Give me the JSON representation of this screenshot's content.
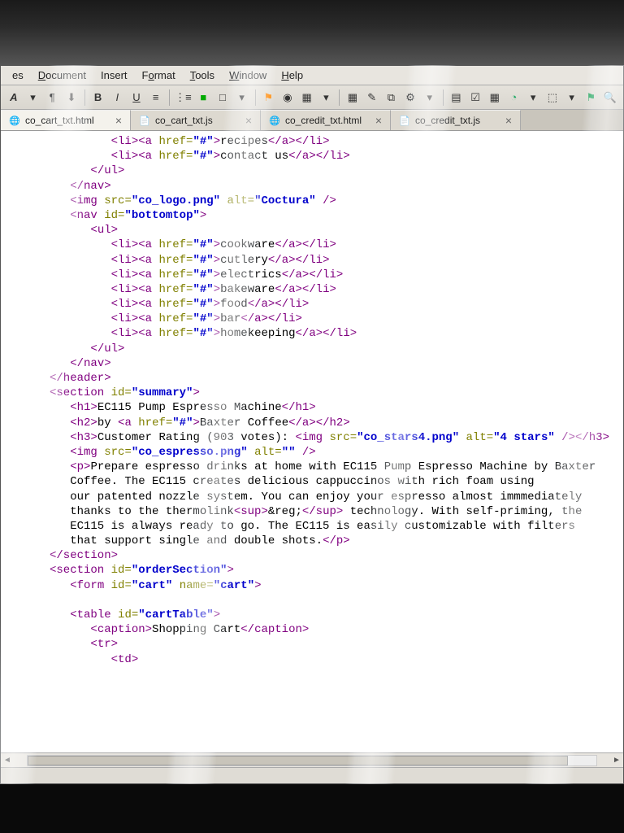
{
  "menu": {
    "items": [
      "es",
      "Document",
      "Insert",
      "Format",
      "Tools",
      "Window",
      "Help"
    ],
    "mnemonics": [
      "",
      "D",
      "",
      "o",
      "T",
      "W",
      "H"
    ]
  },
  "toolbar_icons": [
    "A",
    "▾",
    "¶",
    "⬇",
    "B",
    "I",
    "U",
    "≡",
    "⋮≡",
    "■",
    "□",
    "▾",
    "|",
    "⚑",
    "◉",
    "▦",
    "▾",
    "▦",
    "✎",
    "⧉",
    "⚙",
    "▾",
    "▤",
    "☑",
    "▦",
    "◔",
    "▾",
    "⬚",
    "▾",
    "⚑",
    "🔍"
  ],
  "tabs": [
    {
      "icon": "🌐",
      "label": "co_cart_txt.html",
      "active": true
    },
    {
      "icon": "📄",
      "label": "co_cart_txt.js",
      "active": false
    },
    {
      "icon": "🌐",
      "label": "co_credit_txt.html",
      "active": false
    },
    {
      "icon": "📄",
      "label": "co_credit_txt.js",
      "active": false
    }
  ],
  "code": {
    "prefix": "       ",
    "lines": [
      {
        "indent": 3,
        "html": "<span class='tag'>&lt;li&gt;&lt;a</span> <span class='attr-name'>href=</span><span class='attr-val'>\"#\"</span><span class='tag'>&gt;</span>recipes<span class='tag'>&lt;/a&gt;&lt;/li&gt;</span>"
      },
      {
        "indent": 3,
        "html": "<span class='tag'>&lt;li&gt;&lt;a</span> <span class='attr-name'>href=</span><span class='attr-val'>\"#\"</span><span class='tag'>&gt;</span>contact us<span class='tag'>&lt;/a&gt;&lt;/li&gt;</span>"
      },
      {
        "indent": 2,
        "html": "<span class='tag'>&lt;/ul&gt;</span>"
      },
      {
        "indent": 1,
        "html": "<span class='tag'>&lt;/nav&gt;</span>"
      },
      {
        "indent": 1,
        "html": "<span class='tag'>&lt;img</span> <span class='attr-name'>src=</span><span class='attr-val'>\"co_logo.png\"</span> <span class='attr-name'>alt=</span><span class='attr-val'>\"Coctura\"</span> <span class='tag'>/&gt;</span>"
      },
      {
        "indent": 1,
        "html": "<span class='tag'>&lt;nav</span> <span class='attr-name'>id=</span><span class='attr-val'>\"bottomtop\"</span><span class='tag'>&gt;</span>"
      },
      {
        "indent": 2,
        "html": "<span class='tag'>&lt;ul&gt;</span>"
      },
      {
        "indent": 3,
        "html": "<span class='tag'>&lt;li&gt;&lt;a</span> <span class='attr-name'>href=</span><span class='attr-val'>\"#\"</span><span class='tag'>&gt;</span>cookware<span class='tag'>&lt;/a&gt;&lt;/li&gt;</span>"
      },
      {
        "indent": 3,
        "html": "<span class='tag'>&lt;li&gt;&lt;a</span> <span class='attr-name'>href=</span><span class='attr-val'>\"#\"</span><span class='tag'>&gt;</span>cutlery<span class='tag'>&lt;/a&gt;&lt;/li&gt;</span>"
      },
      {
        "indent": 3,
        "html": "<span class='tag'>&lt;li&gt;&lt;a</span> <span class='attr-name'>href=</span><span class='attr-val'>\"#\"</span><span class='tag'>&gt;</span>electrics<span class='tag'>&lt;/a&gt;&lt;/li&gt;</span>"
      },
      {
        "indent": 3,
        "html": "<span class='tag'>&lt;li&gt;&lt;a</span> <span class='attr-name'>href=</span><span class='attr-val'>\"#\"</span><span class='tag'>&gt;</span>bakeware<span class='tag'>&lt;/a&gt;&lt;/li&gt;</span>"
      },
      {
        "indent": 3,
        "html": "<span class='tag'>&lt;li&gt;&lt;a</span> <span class='attr-name'>href=</span><span class='attr-val'>\"#\"</span><span class='tag'>&gt;</span>food<span class='tag'>&lt;/a&gt;&lt;/li&gt;</span>"
      },
      {
        "indent": 3,
        "html": "<span class='tag'>&lt;li&gt;&lt;a</span> <span class='attr-name'>href=</span><span class='attr-val'>\"#\"</span><span class='tag'>&gt;</span>bar<span class='tag'>&lt;/a&gt;&lt;/li&gt;</span>"
      },
      {
        "indent": 3,
        "html": "<span class='tag'>&lt;li&gt;&lt;a</span> <span class='attr-name'>href=</span><span class='attr-val'>\"#\"</span><span class='tag'>&gt;</span>homekeeping<span class='tag'>&lt;/a&gt;&lt;/li&gt;</span>"
      },
      {
        "indent": 2,
        "html": "<span class='tag'>&lt;/ul&gt;</span>"
      },
      {
        "indent": 1,
        "html": "<span class='tag'>&lt;/nav&gt;</span>"
      },
      {
        "indent": 0,
        "html": "<span class='tag'>&lt;/header&gt;</span>"
      },
      {
        "indent": 0,
        "html": "<span class='tag'>&lt;section</span> <span class='attr-name'>id=</span><span class='attr-val'>\"summary\"</span><span class='tag'>&gt;</span>"
      },
      {
        "indent": 1,
        "html": "<span class='tag'>&lt;h1&gt;</span>EC115 Pump Espresso Machine<span class='tag'>&lt;/h1&gt;</span>"
      },
      {
        "indent": 1,
        "html": "<span class='tag'>&lt;h2&gt;</span>by <span class='tag'>&lt;a</span> <span class='attr-name'>href=</span><span class='attr-val'>\"#\"</span><span class='tag'>&gt;</span>Baxter Coffee<span class='tag'>&lt;/a&gt;&lt;/h2&gt;</span>"
      },
      {
        "indent": 1,
        "html": "<span class='tag'>&lt;h3&gt;</span>Customer Rating (903 votes): <span class='tag'>&lt;img</span> <span class='attr-name'>src=</span><span class='attr-val'>\"co_stars4.png\"</span> <span class='attr-name'>alt=</span><span class='attr-val'>\"4 stars\"</span> <span class='tag'>/&gt;&lt;/h3&gt;</span>"
      },
      {
        "indent": 1,
        "html": "<span class='tag'>&lt;img</span> <span class='attr-name'>src=</span><span class='attr-val'>\"co_espresso.png\"</span> <span class='attr-name'>alt=</span><span class='attr-val'>\"\"</span> <span class='tag'>/&gt;</span>"
      },
      {
        "indent": 1,
        "html": "<span class='tag'>&lt;p&gt;</span>Prepare espresso drinks at home with EC115 Pump Espresso Machine by Baxter"
      },
      {
        "indent": 1,
        "html": "Coffee. The EC115 creates delicious cappuccinos with rich foam using"
      },
      {
        "indent": 1,
        "html": "our patented nozzle system. You can enjoy your espresso almost immmediately"
      },
      {
        "indent": 1,
        "html": "thanks to the thermolink<span class='tag'>&lt;sup&gt;</span>&amp;reg;<span class='tag'>&lt;/sup&gt;</span> technology. With self-priming, the"
      },
      {
        "indent": 1,
        "html": "EC115 is always ready to go. The EC115 is easily customizable with filters"
      },
      {
        "indent": 1,
        "html": "that support single and double shots.<span class='tag'>&lt;/p&gt;</span>"
      },
      {
        "indent": 0,
        "html": "<span class='tag'>&lt;/section&gt;</span>"
      },
      {
        "indent": 0,
        "html": ""
      },
      {
        "indent": 0,
        "html": "<span class='tag'>&lt;section</span> <span class='attr-name'>id=</span><span class='attr-val'>\"orderSection\"</span><span class='tag'>&gt;</span>"
      },
      {
        "indent": 1,
        "html": "<span class='tag'>&lt;form</span> <span class='attr-name'>id=</span><span class='attr-val'>\"cart\"</span> <span class='attr-name'>name=</span><span class='attr-val'>\"cart\"</span><span class='tag'>&gt;</span>"
      },
      {
        "indent": 1,
        "html": ""
      },
      {
        "indent": 1,
        "html": "<span class='tag'>&lt;table</span> <span class='attr-name'>id=</span><span class='attr-val'>\"cartTable\"</span><span class='tag'>&gt;</span>"
      },
      {
        "indent": 2,
        "html": "<span class='tag'>&lt;caption&gt;</span>Shopping Cart<span class='tag'>&lt;/caption&gt;</span>"
      },
      {
        "indent": 2,
        "html": "<span class='tag'>&lt;tr&gt;</span>"
      },
      {
        "indent": 3,
        "html": "<span class='tag'>&lt;td&gt;</span>"
      }
    ]
  }
}
